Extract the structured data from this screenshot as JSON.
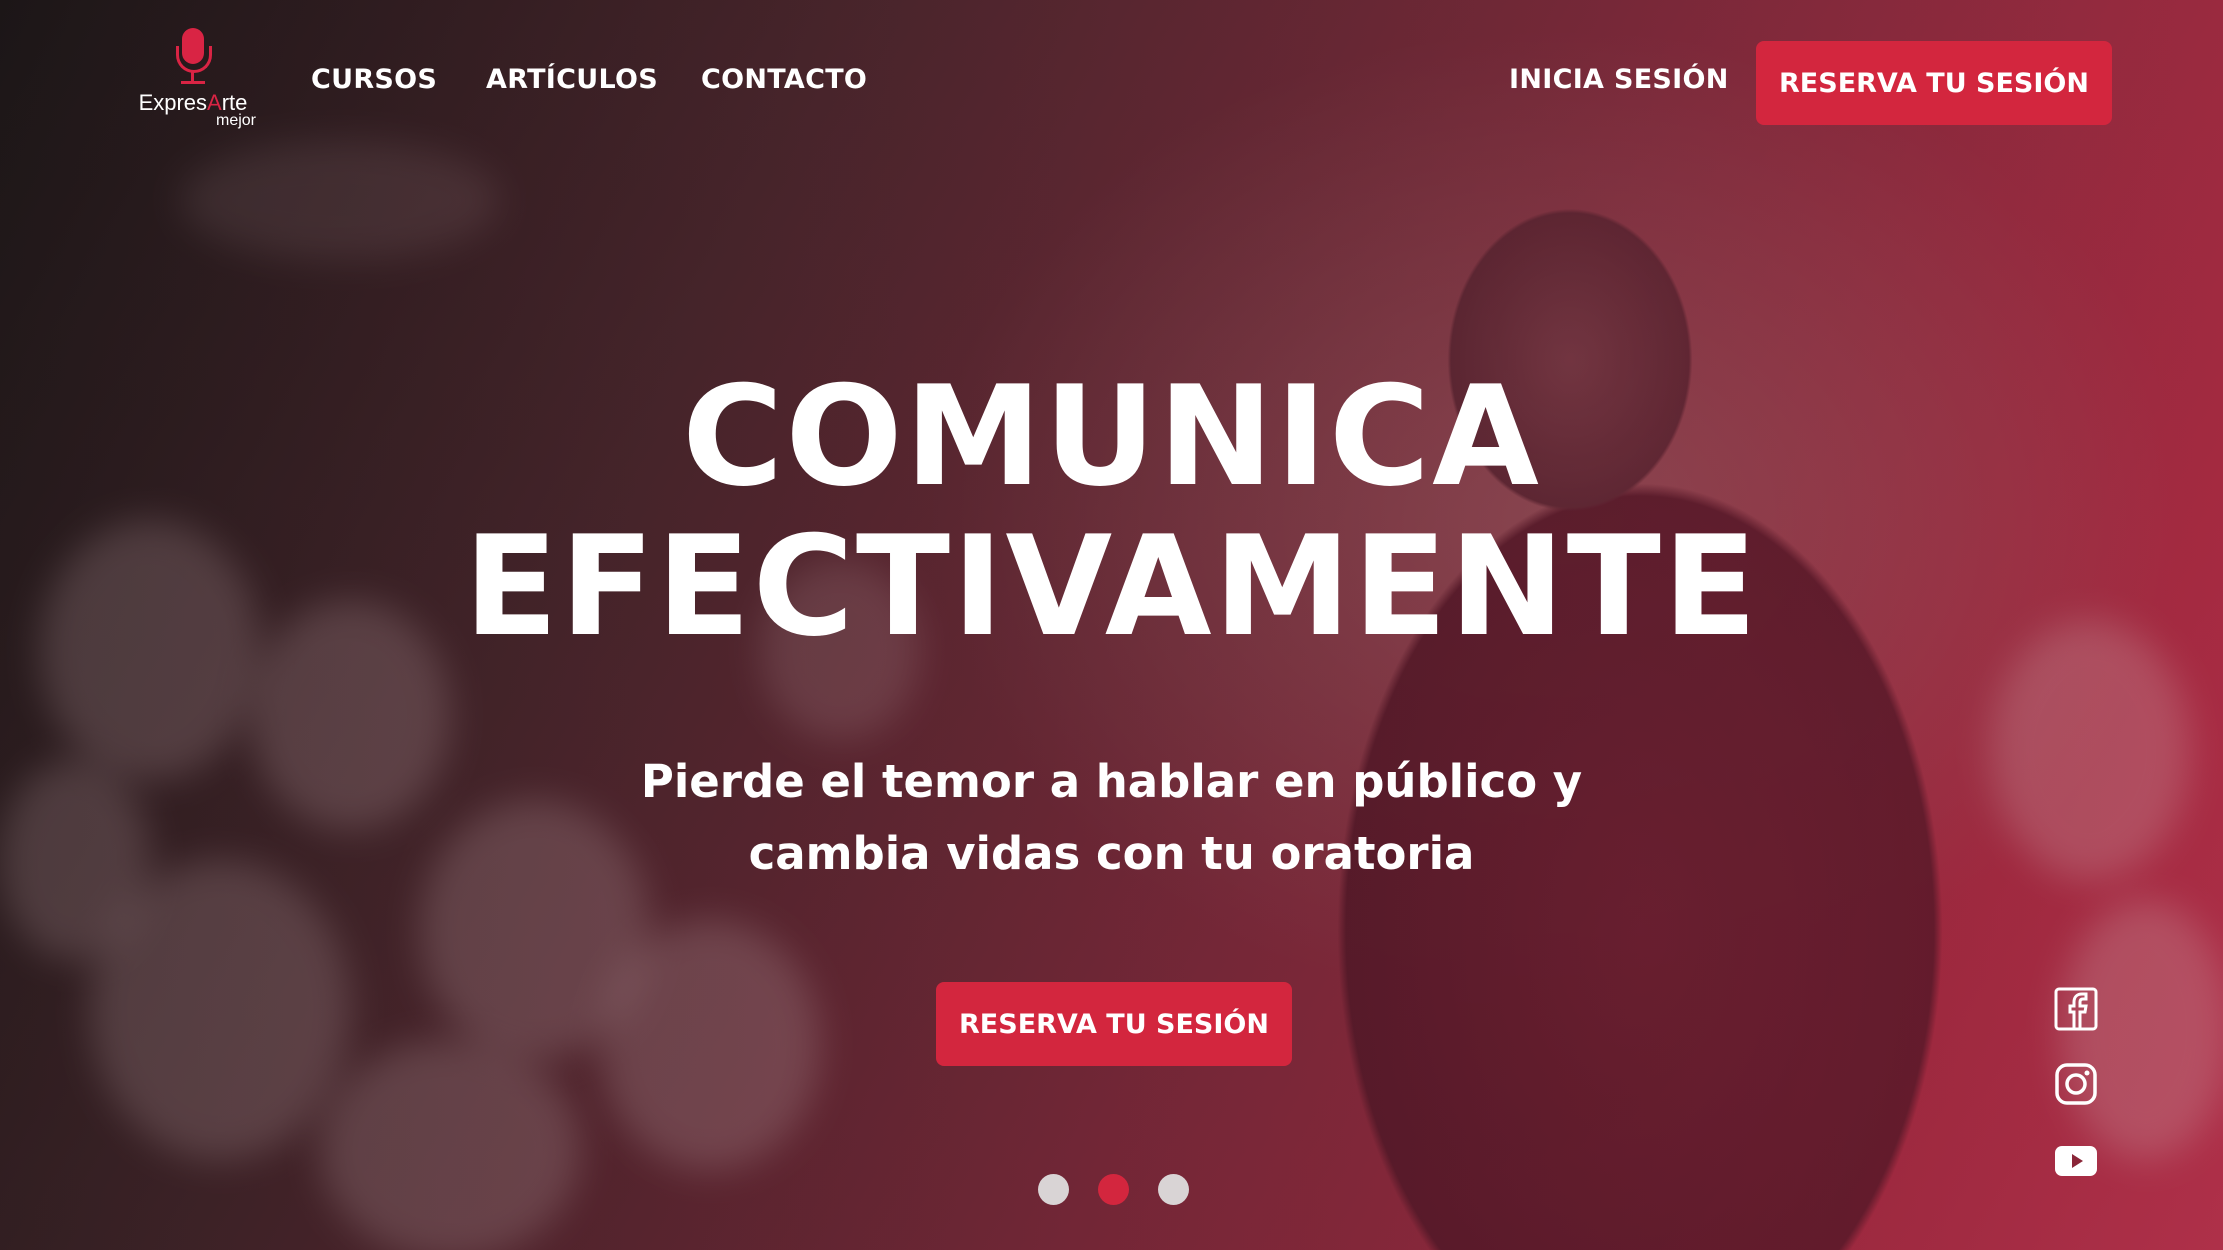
{
  "brand": {
    "name_part1": "Expres",
    "name_accent": "A",
    "name_part2": "rte",
    "tagline": "mejor"
  },
  "nav": {
    "courses": "CURSOS",
    "articles": "ARTÍCULOS",
    "contact": "CONTACTO"
  },
  "header": {
    "login": "INICIA SESIÓN",
    "cta": "RESERVA TU SESIÓN"
  },
  "hero": {
    "title_line1": "COMUNICA",
    "title_line2": "EFECTIVAMENTE",
    "subtitle_line1": "Pierde el temor a hablar en público y",
    "subtitle_line2": "cambia vidas con tu oratoria",
    "cta": "RESERVA TU SESIÓN"
  },
  "social": [
    "facebook-icon",
    "instagram-icon",
    "youtube-icon"
  ],
  "carousel": {
    "slides": 3,
    "active": 2
  },
  "colors": {
    "accent": "#d3263e",
    "text": "#ffffff"
  }
}
